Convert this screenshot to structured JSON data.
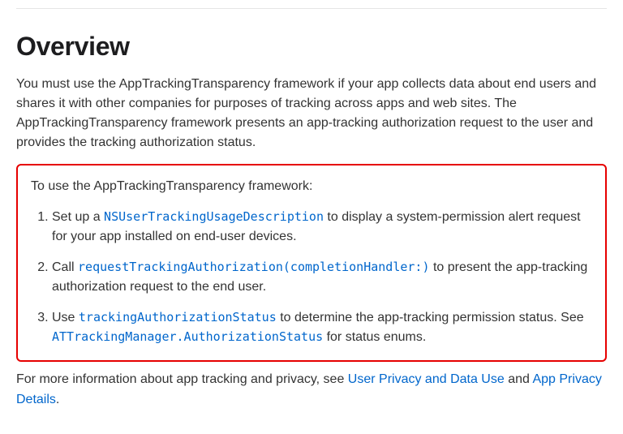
{
  "heading": "Overview",
  "intro": "You must use the AppTrackingTransparency framework if your app collects data about end users and shares it with other companies for purposes of tracking across apps and web sites. The AppTrackingTransparency framework presents an app-tracking authorization request to the user and provides the tracking authorization status.",
  "callout_lead": "To use the AppTrackingTransparency framework:",
  "steps": [
    {
      "pre": "Set up a ",
      "code": "NSUserTrackingUsageDescription",
      "post": " to display a system-permission alert request for your app installed on end-user devices."
    },
    {
      "pre": "Call ",
      "code": "requestTrackingAuthorization(completionHandler:)",
      "post": " to present the app-tracking authorization request to the end user."
    },
    {
      "pre": "Use ",
      "code": "trackingAuthorizationStatus",
      "post": " to determine the app-tracking permission status. See ",
      "code2": "ATTrackingManager.AuthorizationStatus",
      "post2": " for status enums."
    }
  ],
  "footer": {
    "pre": "For more information about app tracking and privacy, see ",
    "link1": "User Privacy and Data Use",
    "mid": " and ",
    "link2": "App Privacy Details",
    "post": "."
  }
}
